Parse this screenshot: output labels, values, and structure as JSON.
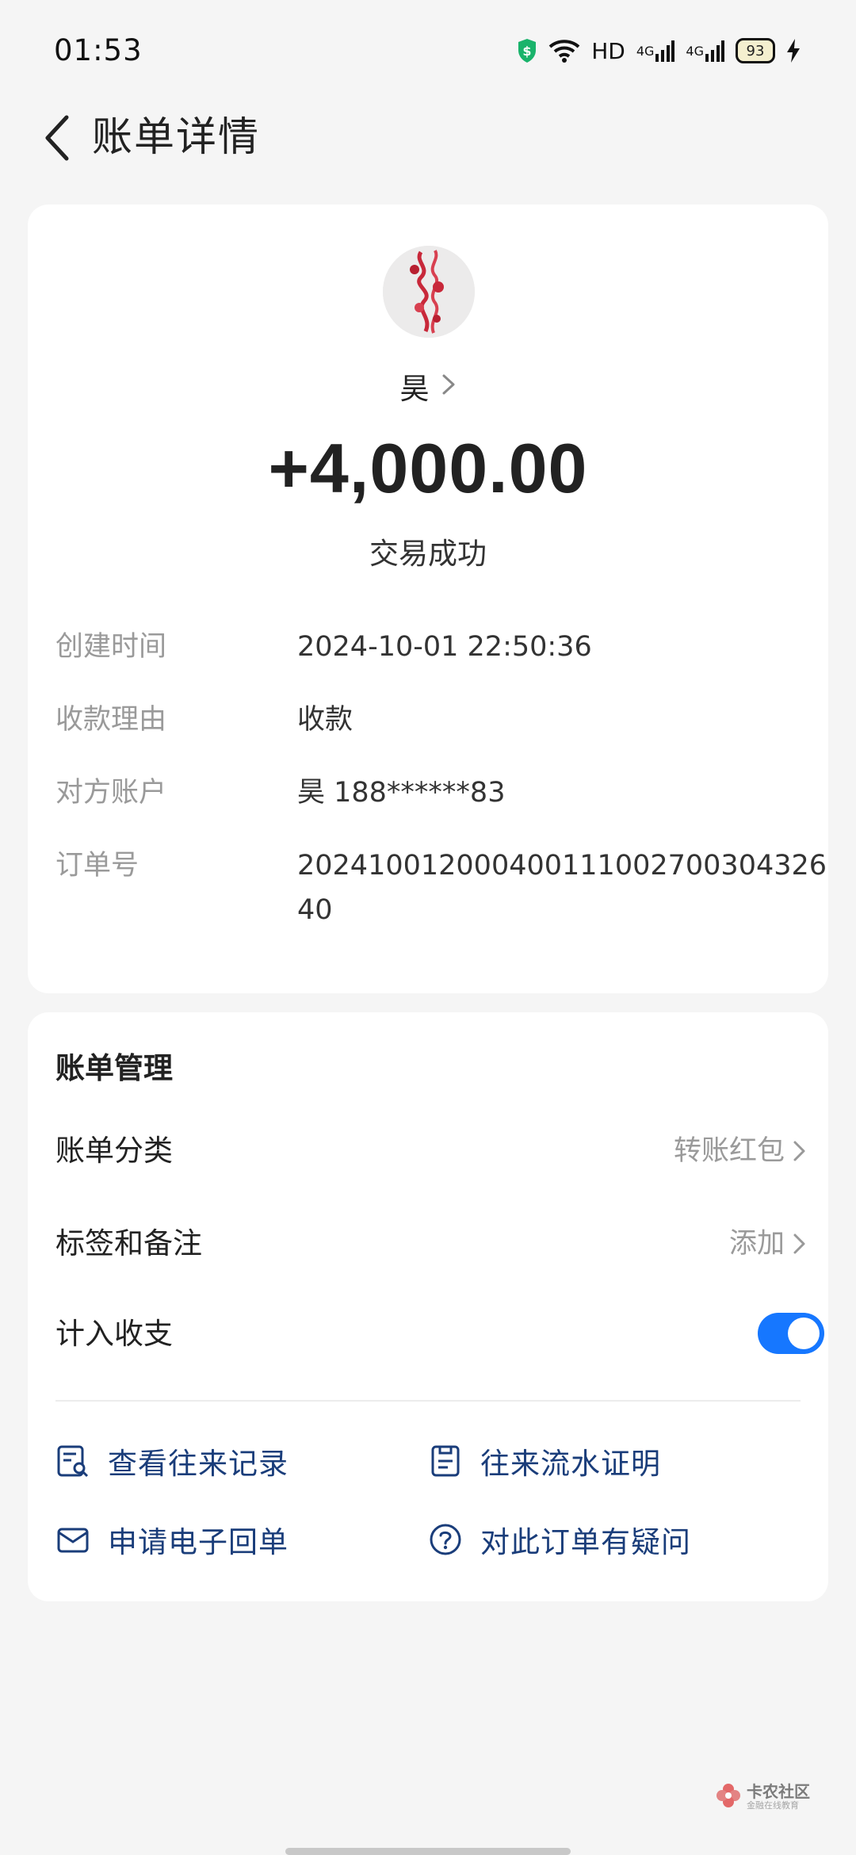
{
  "status_bar": {
    "time": "01:53",
    "hd_label": "HD",
    "net1": "4G",
    "net2": "4G",
    "battery": "93",
    "icons": [
      "shield-icon",
      "wifi-icon",
      "signal-icon",
      "signal-icon",
      "battery-icon",
      "charging-icon"
    ]
  },
  "header": {
    "title": "账单详情",
    "back_icon": "chevron-left-icon"
  },
  "transaction": {
    "payer_name": "昊",
    "amount": "+4,000.00",
    "status": "交易成功",
    "details": [
      {
        "label": "创建时间",
        "value": "2024-10-01 22:50:36"
      },
      {
        "label": "收款理由",
        "value": "收款"
      },
      {
        "label": "对方账户",
        "value": "昊 188******83"
      },
      {
        "label": "订单号",
        "value": "202410012000400111002700304326 40"
      }
    ]
  },
  "management": {
    "title": "账单管理",
    "rows": [
      {
        "label": "账单分类",
        "value": "转账红包"
      },
      {
        "label": "标签和备注",
        "value": "添加"
      },
      {
        "label": "计入收支",
        "toggle_on": true
      }
    ],
    "actions": [
      {
        "label": "查看往来记录",
        "icon": "record-search-icon"
      },
      {
        "label": "往来流水证明",
        "icon": "statement-icon"
      },
      {
        "label": "申请电子回单",
        "icon": "envelope-icon"
      },
      {
        "label": "对此订单有疑问",
        "icon": "question-icon"
      }
    ]
  },
  "watermark": {
    "text": "卡农社区",
    "sub": "金融在线教育"
  },
  "colors": {
    "accent": "#1677ff",
    "action_text": "#1a3d7a",
    "muted": "#9a9a9a",
    "background": "#f5f5f5"
  }
}
